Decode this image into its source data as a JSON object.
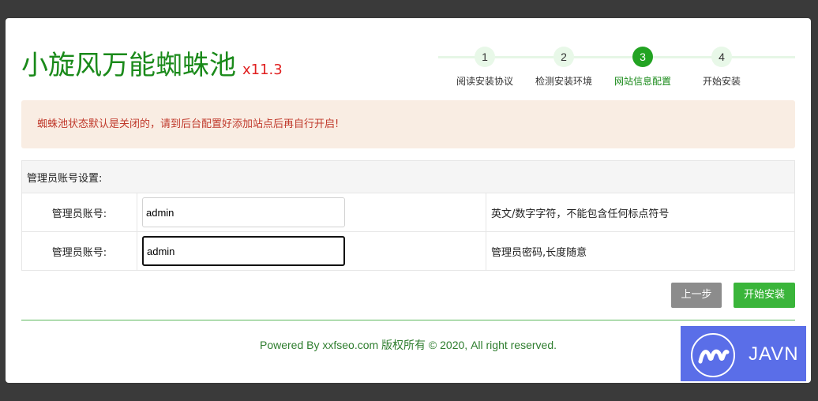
{
  "header": {
    "title": "小旋风万能蜘蛛池",
    "version": "x11.3"
  },
  "steps": [
    {
      "num": "1",
      "label": "阅读安装协议"
    },
    {
      "num": "2",
      "label": "检测安装环境"
    },
    {
      "num": "3",
      "label": "网站信息配置"
    },
    {
      "num": "4",
      "label": "开始安装"
    }
  ],
  "active_step": "3",
  "alert": "蜘蛛池状态默认是关闭的，请到后台配置好添加站点后再自行开启!",
  "form": {
    "section_title": "管理员账号设置:",
    "rows": [
      {
        "label": "管理员账号:",
        "value": "admin",
        "hint": "英文/数字字符，不能包含任何标点符号"
      },
      {
        "label": "管理员账号:",
        "value": "admin",
        "hint": "管理员密码,长度随意"
      }
    ]
  },
  "buttons": {
    "prev": "上一步",
    "install": "开始安装"
  },
  "footer": "Powered By xxfseo.com 版权所有 © 2020, All right reserved.",
  "watermark": {
    "text": "JAVN",
    "icon": "javn-logo-icon"
  },
  "colors": {
    "brand_green": "#1a8a1a",
    "version_red": "#e02020",
    "alert_bg": "#f9ede3",
    "alert_text": "#c0392b",
    "button_green": "#3ab53a",
    "button_gray": "#8c8c8c",
    "watermark_bg": "#5a6ee8"
  }
}
